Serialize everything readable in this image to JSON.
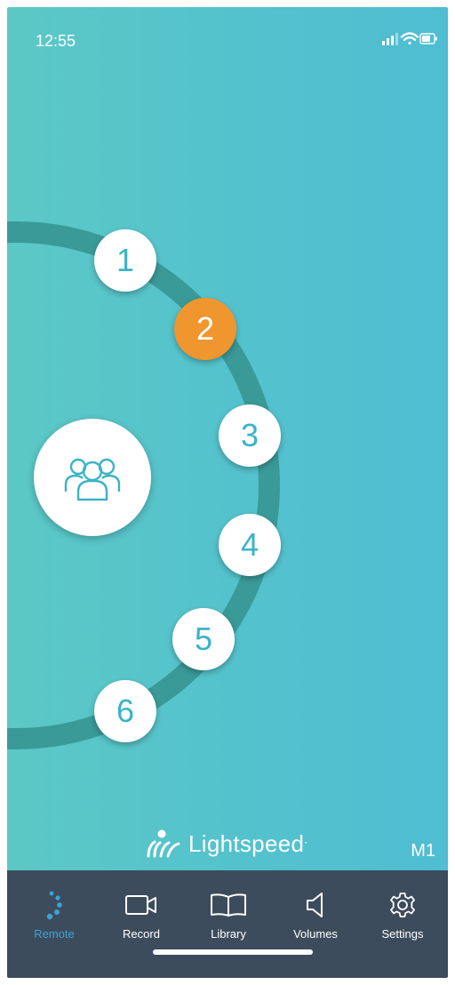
{
  "status": {
    "time": "12:55"
  },
  "zones": [
    {
      "label": "1",
      "active": false
    },
    {
      "label": "2",
      "active": true
    },
    {
      "label": "3",
      "active": false
    },
    {
      "label": "4",
      "active": false
    },
    {
      "label": "5",
      "active": false
    },
    {
      "label": "6",
      "active": false
    }
  ],
  "group_icon": "group-people-icon",
  "brand": {
    "name": "Lightspeed",
    "mark": "."
  },
  "mode": "M1",
  "tabs": [
    {
      "label": "Remote",
      "icon": "remote-dots-icon",
      "active": true
    },
    {
      "label": "Record",
      "icon": "video-camera-icon",
      "active": false
    },
    {
      "label": "Library",
      "icon": "book-icon",
      "active": false
    },
    {
      "label": "Volumes",
      "icon": "speaker-icon",
      "active": false
    },
    {
      "label": "Settings",
      "icon": "gear-icon",
      "active": false
    }
  ],
  "colors": {
    "active_zone": "#f0962e",
    "active_tab": "#3aa4d8",
    "tabbar": "#3d4c5c",
    "ring": "#3a9a98"
  }
}
